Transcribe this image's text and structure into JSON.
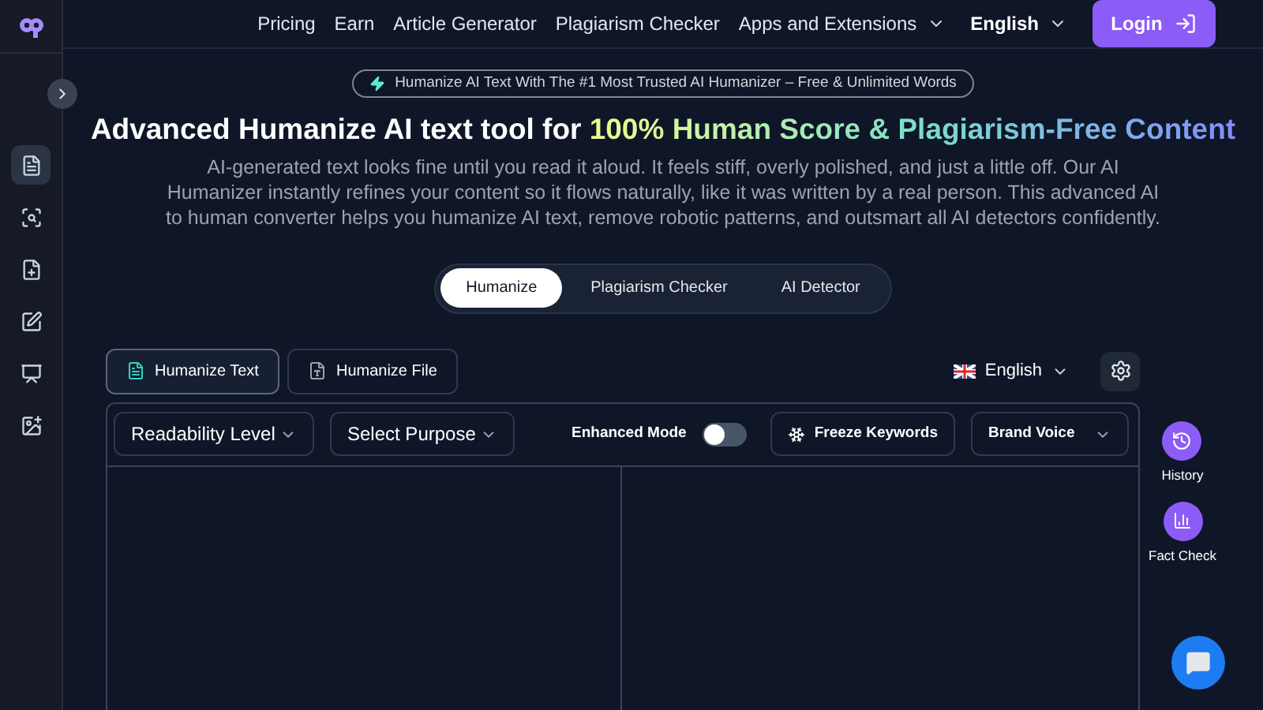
{
  "nav": {
    "links": [
      {
        "label": "Pricing",
        "kind": "link"
      },
      {
        "label": "Earn",
        "kind": "link"
      },
      {
        "label": "Article Generator",
        "kind": "link"
      },
      {
        "label": "Plagiarism Checker",
        "kind": "link"
      },
      {
        "label": "Apps and Extensions",
        "kind": "dropdown"
      }
    ],
    "language": "English",
    "login": "Login"
  },
  "sidebar": {
    "items": [
      {
        "selected": true
      },
      {
        "selected": false
      },
      {
        "selected": false
      },
      {
        "selected": false
      },
      {
        "selected": false
      },
      {
        "selected": false
      }
    ]
  },
  "badge": "Humanize AI Text With The #1 Most Trusted AI Humanizer – Free & Unlimited Words",
  "headline": {
    "plain": "Advanced Humanize AI text tool for ",
    "highlight": "100% Human Score & Plagiarism-Free Content"
  },
  "intro": "AI-generated text looks fine until you read it aloud. It feels stiff, overly polished, and just a little off. Our AI Humanizer instantly refines your content so it flows naturally, like it was written by a real person. This advanced AI to human converter helps you humanize AI text, remove robotic patterns, and outsmart all AI detectors confidently.",
  "tool_tabs": [
    {
      "label": "Humanize",
      "selected": true
    },
    {
      "label": "Plagiarism Checker",
      "selected": false
    },
    {
      "label": "AI Detector",
      "selected": false
    }
  ],
  "mode_buttons": [
    {
      "label": "Humanize Text",
      "selected": true
    },
    {
      "label": "Humanize File",
      "selected": false
    }
  ],
  "output_language": "English",
  "toolbar": {
    "readability": "Readability Level",
    "purpose": "Select Purpose",
    "enhanced_mode": {
      "label": "Enhanced Mode",
      "on": false
    },
    "freeze": "Freeze Keywords",
    "brand_voice": "Brand Voice"
  },
  "side_actions": [
    {
      "label": "History",
      "kind": "history"
    },
    {
      "label": "Fact Check",
      "kind": "chart"
    }
  ]
}
